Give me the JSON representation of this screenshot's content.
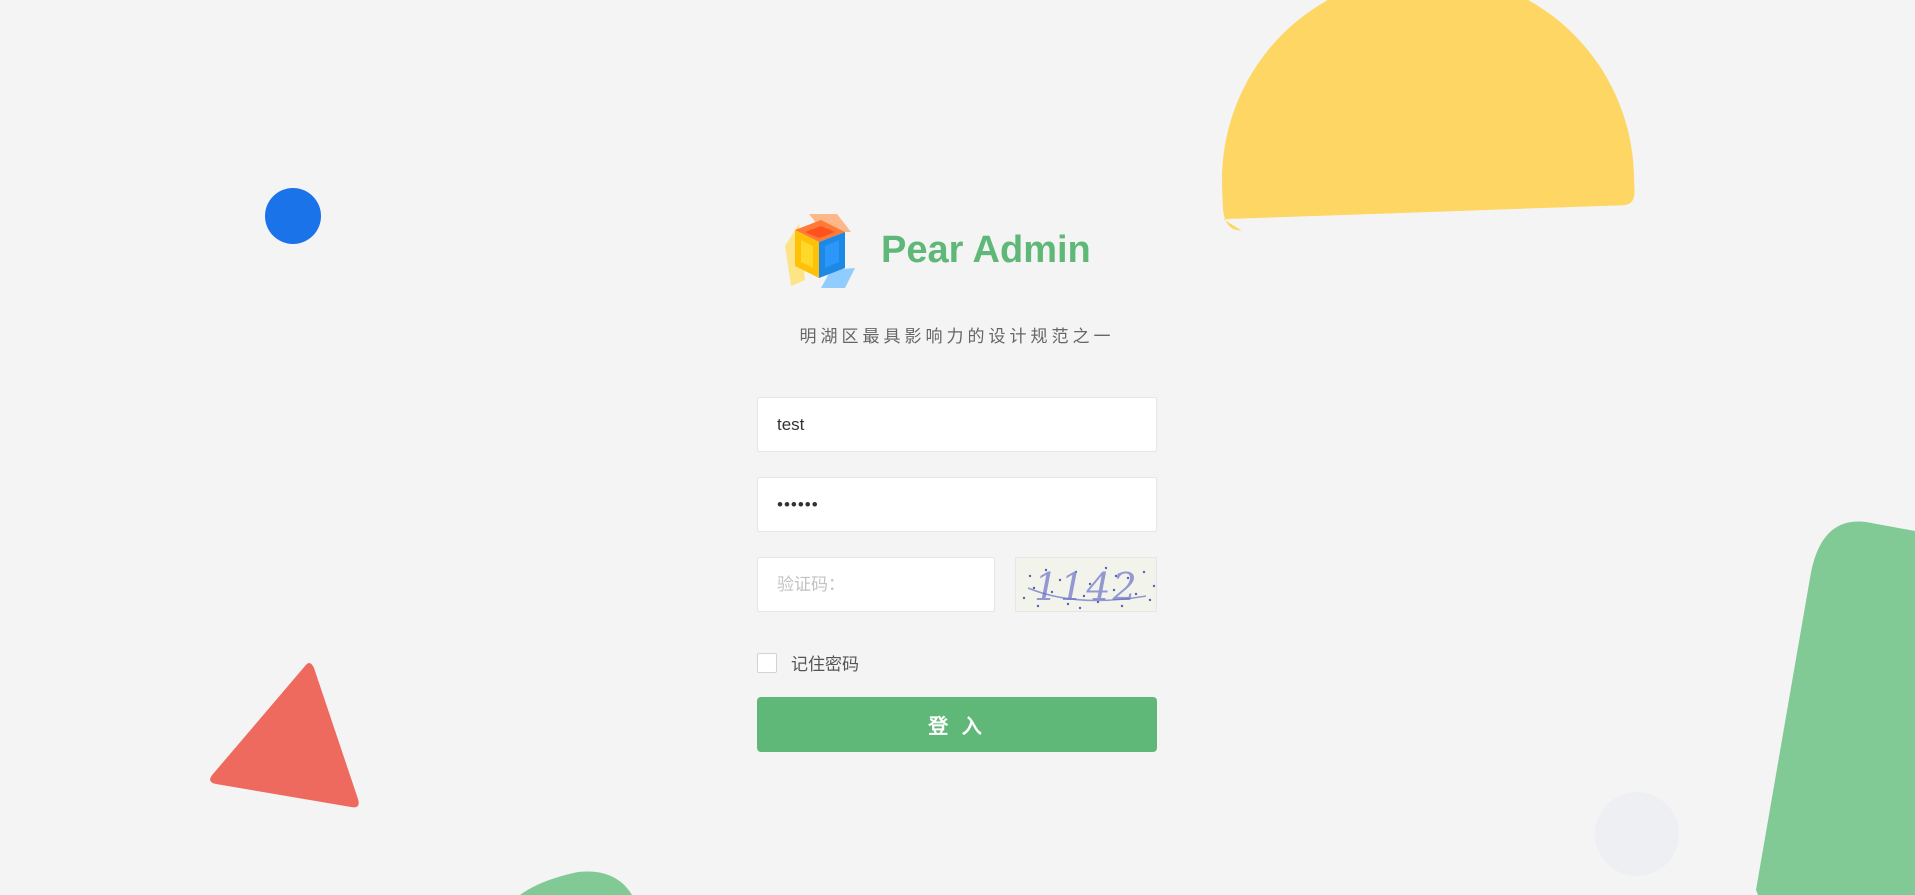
{
  "app": {
    "title": "Pear Admin",
    "slogan": "明湖区最具影响力的设计规范之一"
  },
  "form": {
    "username_value": "test",
    "password_value": "123456",
    "captcha_placeholder": "验证码：",
    "captcha_image_text": "1142",
    "remember_label": "记住密码",
    "remember_checked": false,
    "submit_label": "登 入"
  },
  "colors": {
    "brand_green": "#5fb878",
    "background": "#f4f4f4",
    "decor_yellow": "#fdd663",
    "decor_blue": "#1a73e8",
    "decor_red": "#ee6a5e",
    "decor_green": "#81c995"
  },
  "icons": {
    "logo": "pear-cube-logo-icon"
  }
}
